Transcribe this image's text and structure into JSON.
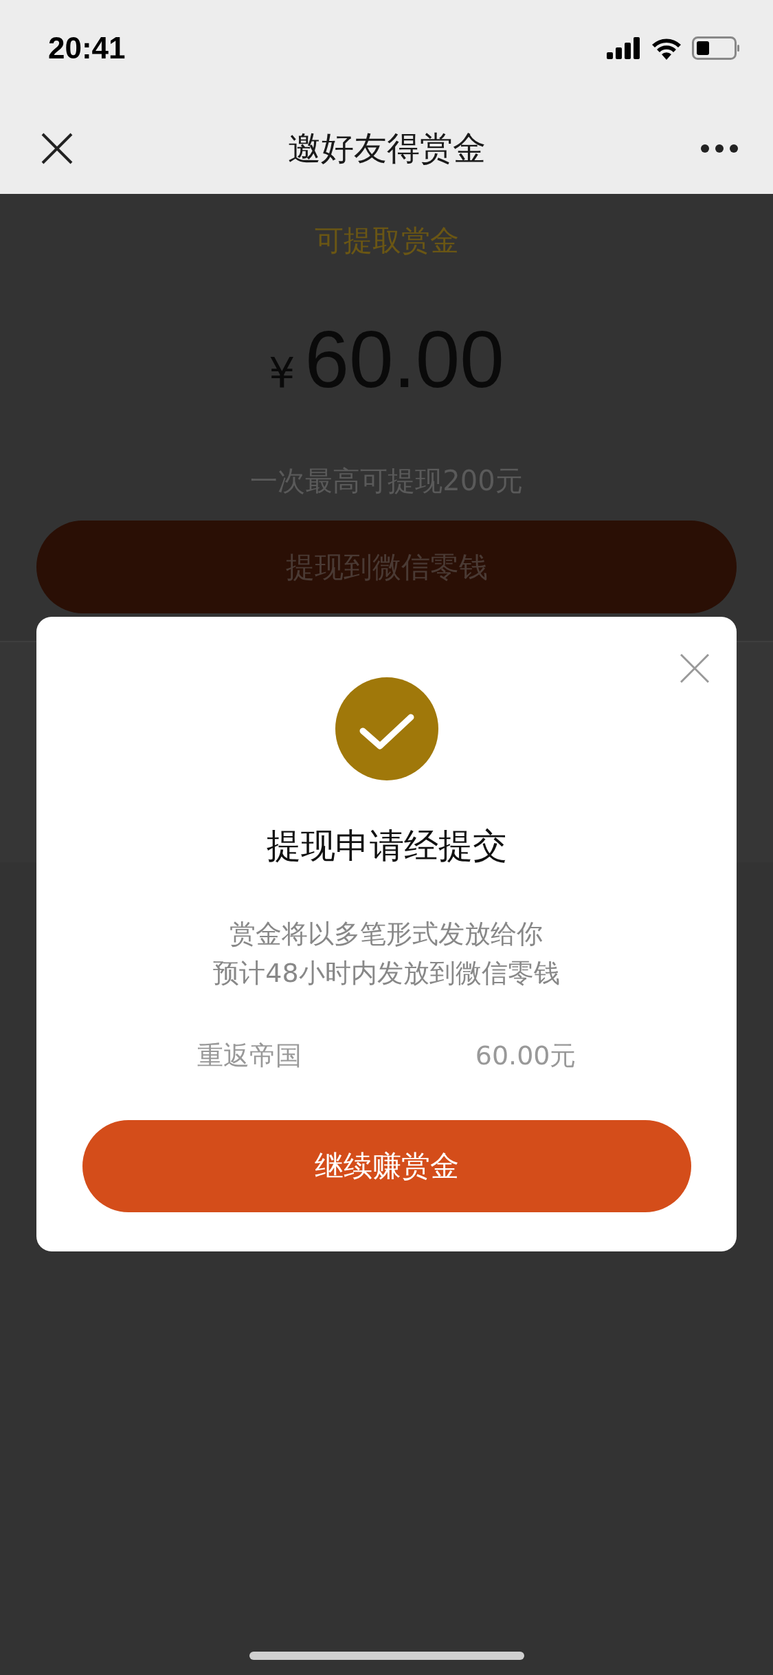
{
  "status_bar": {
    "time": "20:41"
  },
  "nav": {
    "title": "邀好友得赏金"
  },
  "page": {
    "label": "可提取赏金",
    "currency": "¥",
    "amount": "60.00",
    "limit_note": "一次最高可提现200元",
    "withdraw_button": "提现到微信零钱"
  },
  "dialog": {
    "title": "提现申请经提交",
    "lines": [
      "赏金将以多笔形式发放给你",
      "预计48小时内发放到微信零钱"
    ],
    "item": {
      "name": "重返帝国",
      "amount": "60.00元"
    },
    "button": "继续赚赏金"
  }
}
